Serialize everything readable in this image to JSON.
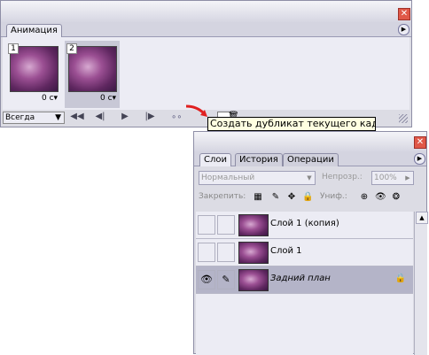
{
  "animation_panel": {
    "tab_label": "Анимация",
    "frames": [
      {
        "number": "1",
        "delay": "0 с"
      },
      {
        "number": "2",
        "delay": "0 с"
      }
    ],
    "loop_value": "Всегда",
    "icons": [
      "first-frame-icon",
      "prev-frame-icon",
      "play-icon",
      "next-frame-icon",
      "tween-icon",
      "duplicate-frame-icon",
      "delete-frame-icon"
    ]
  },
  "tooltip": {
    "text": "Создать дубликат текущего кадра"
  },
  "layers_panel": {
    "tabs": [
      "Слои",
      "История",
      "Операции"
    ],
    "blend_mode": "Нормальный",
    "opacity_label": "Непрозр.:",
    "opacity_value": "100%",
    "lock_label": "Закрепить:",
    "unify_label": "Униф.:",
    "layers": [
      {
        "name": "Слой 1 (копия)",
        "visible": false,
        "active": false
      },
      {
        "name": "Слой 1",
        "visible": false,
        "active": false
      },
      {
        "name": "Задний план",
        "visible": true,
        "active": true
      }
    ]
  },
  "colors": {
    "panel_bg": "#dcdce4",
    "active_layer": "#b4b4c8",
    "tooltip_bg": "#ffffe1",
    "close_red": "#e05848"
  }
}
